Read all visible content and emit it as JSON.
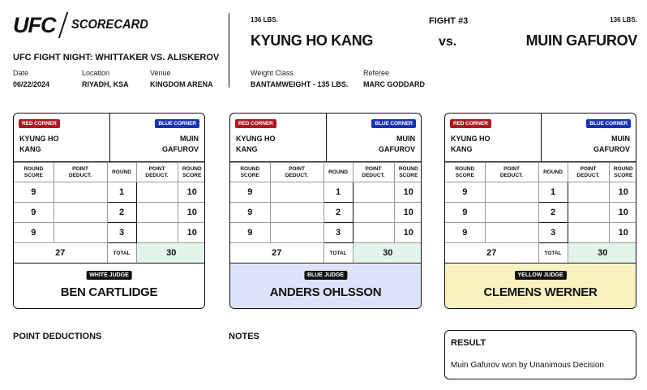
{
  "header": {
    "logo_text": "UFC",
    "logo_sub": "SCORECARD",
    "event": "UFC FIGHT NIGHT: WHITTAKER VS. ALISKEROV",
    "date_label": "Date",
    "date": "06/22/2024",
    "location_label": "Location",
    "location": "RIYADH, KSA",
    "venue_label": "Venue",
    "venue": "KINGDOM ARENA"
  },
  "fight": {
    "red_weight": "136 LBS.",
    "red_name": "KYUNG HO KANG",
    "fight_number": "FIGHT #3",
    "vs": "vs.",
    "blue_weight": "136 LBS.",
    "blue_name": "MUIN GAFUROV",
    "weight_class_label": "Weight Class",
    "weight_class": "BANTAMWEIGHT - 135 LBS.",
    "referee_label": "Referee",
    "referee": "MARC GODDARD"
  },
  "labels": {
    "red_corner": "RED CORNER",
    "blue_corner": "BLUE CORNER",
    "red_first": "KYUNG HO",
    "red_last": "KANG",
    "blue_first": "MUIN",
    "blue_last": "GAFUROV",
    "round_score": "ROUND\nSCORE",
    "point_deduct": "POINT\nDEDUCT.",
    "round": "ROUND",
    "total": "TOTAL"
  },
  "colors": {
    "red_tag": "#b0171f",
    "blue_tag": "#1532b8",
    "white_judge_bg": "#ffffff",
    "blue_judge_bg": "#dfe3fa",
    "yellow_judge_bg": "#f9f3c0",
    "total_winner_bg": "#e3f5ea"
  },
  "cards": [
    {
      "judge_tag": "WHITE JUDGE",
      "judge_name": "BEN CARTLIDGE",
      "rounds": [
        {
          "round": "1",
          "red": "9",
          "red_ded": "",
          "blue_ded": "",
          "blue": "10"
        },
        {
          "round": "2",
          "red": "9",
          "red_ded": "",
          "blue_ded": "",
          "blue": "10"
        },
        {
          "round": "3",
          "red": "9",
          "red_ded": "",
          "blue_ded": "",
          "blue": "10"
        }
      ],
      "red_total": "27",
      "blue_total": "30"
    },
    {
      "judge_tag": "BLUE JUDGE",
      "judge_name": "ANDERS OHLSSON",
      "rounds": [
        {
          "round": "1",
          "red": "9",
          "red_ded": "",
          "blue_ded": "",
          "blue": "10"
        },
        {
          "round": "2",
          "red": "9",
          "red_ded": "",
          "blue_ded": "",
          "blue": "10"
        },
        {
          "round": "3",
          "red": "9",
          "red_ded": "",
          "blue_ded": "",
          "blue": "10"
        }
      ],
      "red_total": "27",
      "blue_total": "30"
    },
    {
      "judge_tag": "YELLOW JUDGE",
      "judge_name": "CLEMENS WERNER",
      "rounds": [
        {
          "round": "1",
          "red": "9",
          "red_ded": "",
          "blue_ded": "",
          "blue": "10"
        },
        {
          "round": "2",
          "red": "9",
          "red_ded": "",
          "blue_ded": "",
          "blue": "10"
        },
        {
          "round": "3",
          "red": "9",
          "red_ded": "",
          "blue_ded": "",
          "blue": "10"
        }
      ],
      "red_total": "27",
      "blue_total": "30"
    }
  ],
  "footer": {
    "point_deductions": "POINT DEDUCTIONS",
    "notes": "NOTES",
    "result_label": "RESULT",
    "result_text": "Muin Gafurov won by Unanimous Decision"
  }
}
